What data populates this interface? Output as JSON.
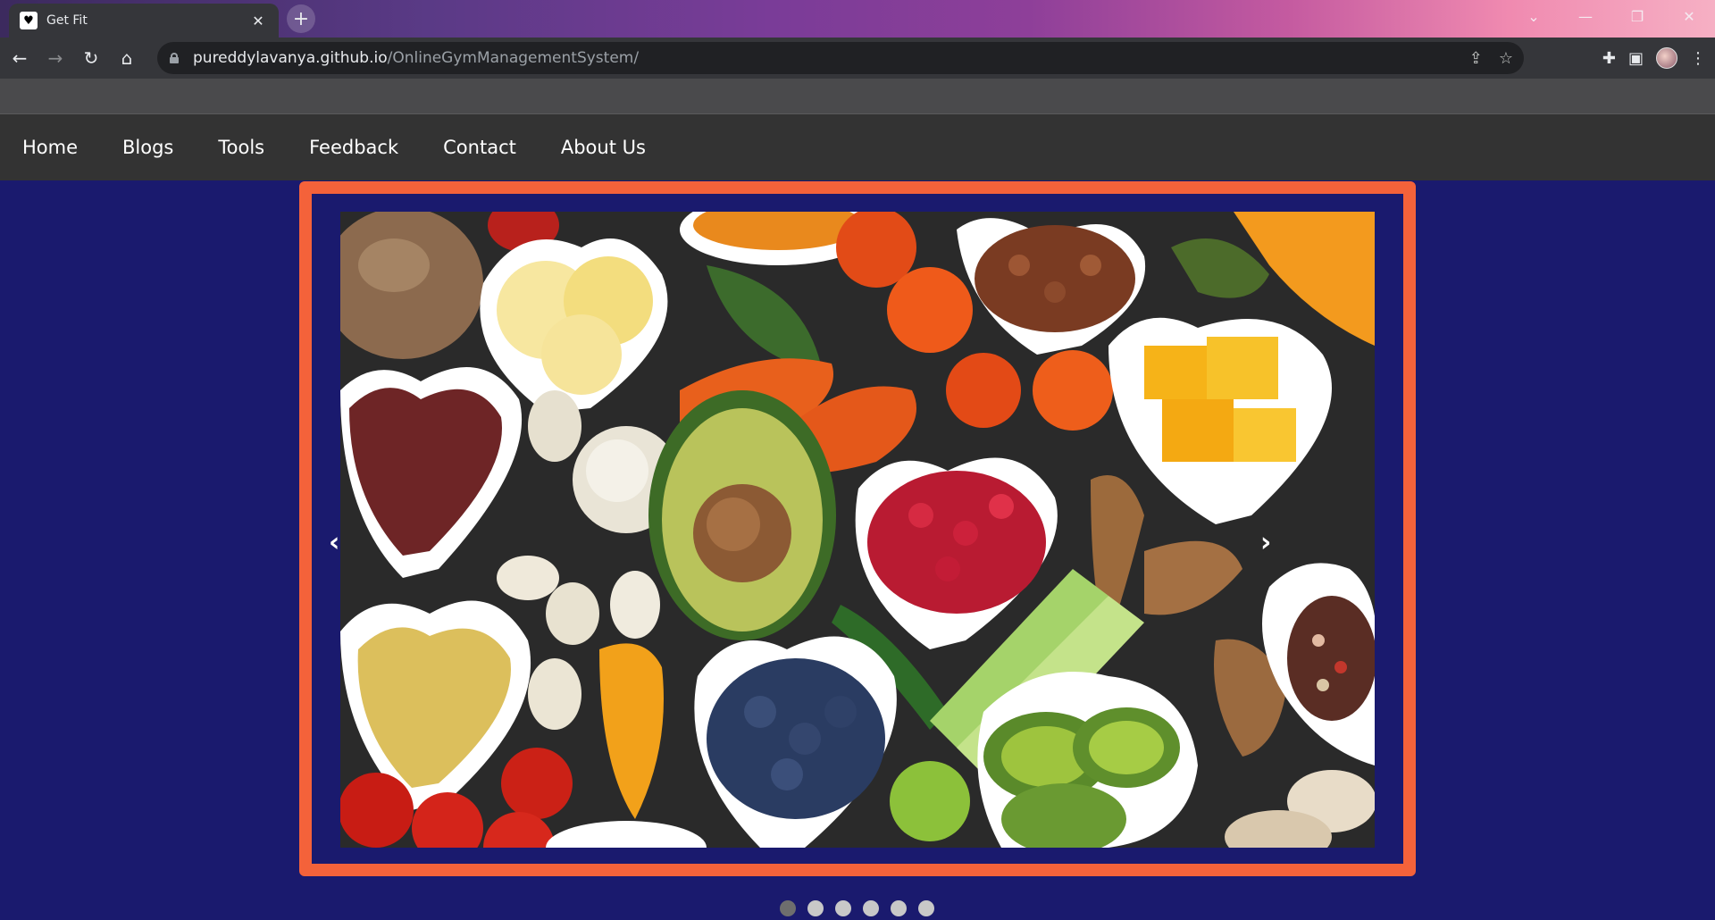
{
  "browser": {
    "tab_title": "Get Fit",
    "tab_close": "✕",
    "new_tab": "+",
    "url_host": "pureddylavanya.github.io",
    "url_path": "/OnlineGymManagementSystem/",
    "window_controls": [
      "⌄",
      "—",
      "❐",
      "✕"
    ]
  },
  "site_nav": {
    "items": [
      "Home",
      "Blogs",
      "Tools",
      "Feedback",
      "Contact",
      "About Us"
    ]
  },
  "carousel": {
    "prev": "‹",
    "next": "›",
    "slide_image": "healthy-food-hearts-bowls",
    "slide_count": 6,
    "active_index": 0,
    "frame_color": "#f4623a",
    "background_color": "#1a1a6e"
  }
}
